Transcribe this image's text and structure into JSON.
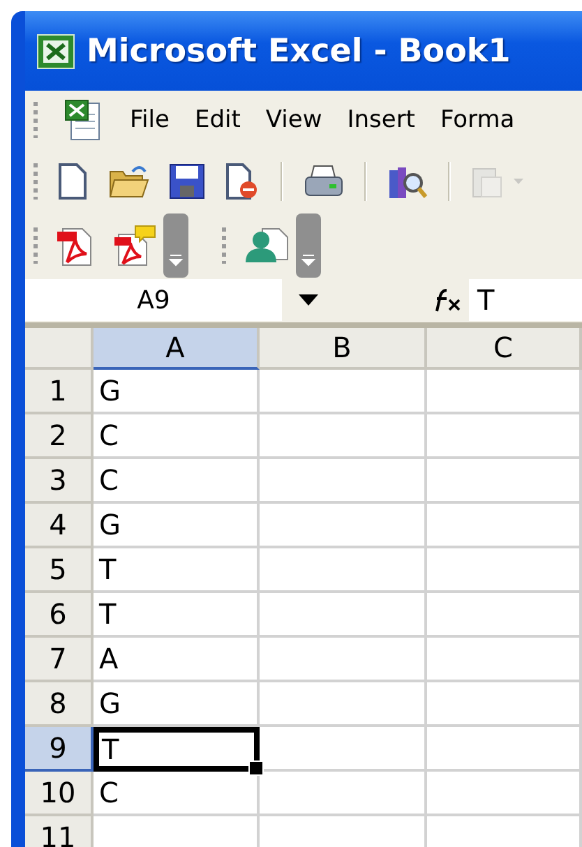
{
  "window": {
    "title": "Microsoft Excel - Book1"
  },
  "menu": [
    {
      "label": "File"
    },
    {
      "label": "Edit"
    },
    {
      "label": "View"
    },
    {
      "label": "Insert"
    },
    {
      "label": "Forma"
    }
  ],
  "toolbar": [
    {
      "kind": "new"
    },
    {
      "kind": "open"
    },
    {
      "kind": "save"
    },
    {
      "kind": "permission"
    },
    {
      "kind": "sep"
    },
    {
      "kind": "print"
    },
    {
      "kind": "sep"
    },
    {
      "kind": "research"
    },
    {
      "kind": "sep"
    },
    {
      "kind": "paste",
      "disabled": true
    }
  ],
  "toolbar_2": [
    {
      "kind": "pdf"
    },
    {
      "kind": "pdf-comment"
    },
    {
      "kind": "more"
    },
    {
      "kind": "gap"
    },
    {
      "kind": "person"
    },
    {
      "kind": "more"
    }
  ],
  "formula_bar": {
    "name_box": "A9",
    "value": "T"
  },
  "sheet": {
    "columns": [
      {
        "label": "A",
        "selected": true
      },
      {
        "label": "B",
        "selected": false
      },
      {
        "label": "C",
        "selected": false
      }
    ],
    "rows": [
      {
        "label": "1",
        "selected": false,
        "cells": [
          "G"
        ]
      },
      {
        "label": "2",
        "selected": false,
        "cells": [
          "C"
        ]
      },
      {
        "label": "3",
        "selected": false,
        "cells": [
          "C"
        ]
      },
      {
        "label": "4",
        "selected": false,
        "cells": [
          "G"
        ]
      },
      {
        "label": "5",
        "selected": false,
        "cells": [
          "T"
        ]
      },
      {
        "label": "6",
        "selected": false,
        "cells": [
          "T"
        ]
      },
      {
        "label": "7",
        "selected": false,
        "cells": [
          "A"
        ]
      },
      {
        "label": "8",
        "selected": false,
        "cells": [
          "G"
        ]
      },
      {
        "label": "9",
        "selected": true,
        "cells": [
          "T"
        ]
      },
      {
        "label": "10",
        "selected": false,
        "cells": [
          "C"
        ]
      },
      {
        "label": "11",
        "selected": false,
        "cells": []
      }
    ]
  }
}
